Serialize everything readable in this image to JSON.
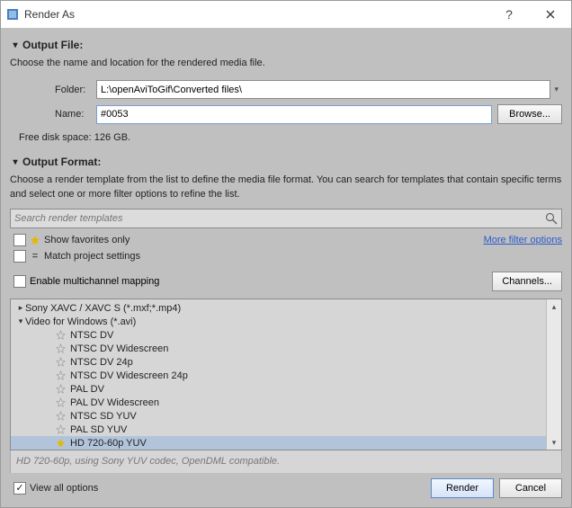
{
  "window": {
    "title": "Render As"
  },
  "output_file": {
    "heading": "Output File:",
    "desc": "Choose the name and location for the rendered media file.",
    "folder_label": "Folder:",
    "folder_value": "L:\\openAviToGif\\Converted files\\",
    "name_label": "Name:",
    "name_value": "#0053",
    "browse": "Browse...",
    "disk": "Free disk space: 126 GB."
  },
  "output_format": {
    "heading": "Output Format:",
    "desc": "Choose a render template from the list to define the media file format. You can search for templates that contain specific terms and select one or more filter options to refine the list.",
    "search_placeholder": "Search render templates",
    "fav_label": "Show favorites only",
    "match_label": "Match project settings",
    "more_filter": "More filter options",
    "multichannel_label": "Enable multichannel mapping",
    "channels_btn": "Channels..."
  },
  "tree": {
    "group1": "Sony XAVC / XAVC S (*.mxf;*.mp4)",
    "group2": "Video for Windows (*.avi)",
    "items": [
      "NTSC DV",
      "NTSC DV Widescreen",
      "NTSC DV 24p",
      "NTSC DV Widescreen 24p",
      "PAL DV",
      "PAL DV Widescreen",
      "NTSC SD YUV",
      "PAL SD YUV",
      "HD 720-60p YUV"
    ]
  },
  "description": "HD 720-60p, using Sony YUV codec, OpenDML compatible.",
  "footer": {
    "view_all": "View all options",
    "render": "Render",
    "cancel": "Cancel"
  }
}
